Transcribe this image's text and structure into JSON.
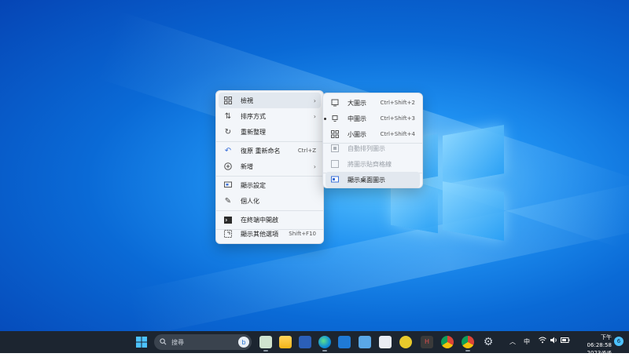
{
  "context_menu": {
    "items": [
      {
        "label": "檢視",
        "icon": "view-grid-icon",
        "has_submenu": true
      },
      {
        "label": "排序方式",
        "icon": "sort-icon",
        "has_submenu": true
      },
      {
        "label": "重新整理",
        "icon": "refresh-icon"
      },
      {
        "label": "復原 重新命名",
        "icon": "undo-icon",
        "shortcut": "Ctrl+Z"
      },
      {
        "label": "新增",
        "icon": "new-plus-icon",
        "has_submenu": true
      },
      {
        "label": "顯示設定",
        "icon": "display-settings-icon"
      },
      {
        "label": "個人化",
        "icon": "personalize-brush-icon"
      },
      {
        "label": "在終端中開啟",
        "icon": "terminal-icon"
      },
      {
        "label": "顯示其他選項",
        "icon": "more-options-icon",
        "shortcut": "Shift+F10"
      }
    ]
  },
  "submenu_view": {
    "items": [
      {
        "label": "大圖示",
        "icon": "large-icons-icon",
        "shortcut": "Ctrl+Shift+2"
      },
      {
        "label": "中圖示",
        "icon": "medium-icons-icon",
        "shortcut": "Ctrl+Shift+3",
        "selected": true
      },
      {
        "label": "小圖示",
        "icon": "small-icons-icon",
        "shortcut": "Ctrl+Shift+4"
      },
      {
        "label": "自動排列圖示",
        "icon": "auto-arrange-icon",
        "disabled": true
      },
      {
        "label": "將圖示貼齊格線",
        "icon": "align-grid-icon",
        "disabled": true
      },
      {
        "label": "顯示桌面圖示",
        "icon": "show-desktop-icons-icon"
      }
    ]
  },
  "taskbar": {
    "search_placeholder": "搜尋",
    "ime_label": "中",
    "clock_time": "下午 06:28:58",
    "clock_date": "2023/6/6",
    "notification_count": "6"
  },
  "colors": {
    "accent": "#0a6ad6",
    "taskbar_bg": "#1c2530",
    "menu_bg": "#f3f6fa"
  }
}
